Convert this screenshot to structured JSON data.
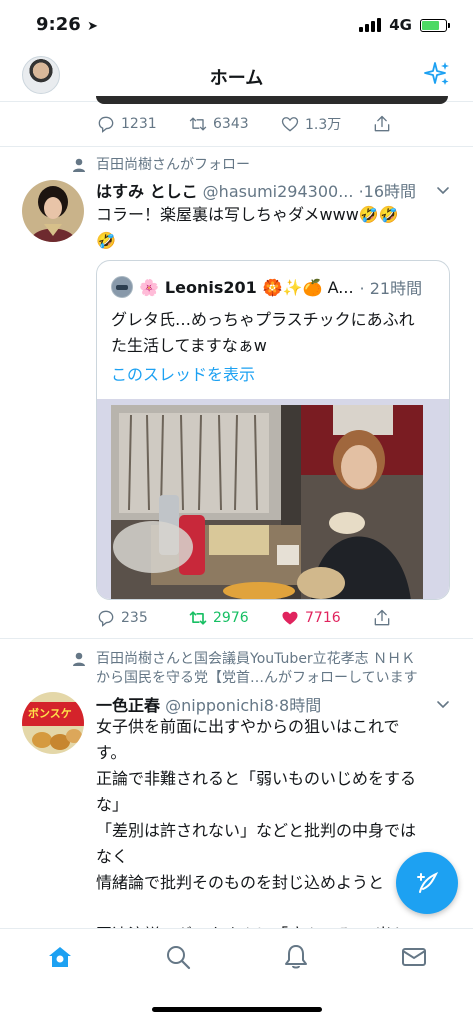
{
  "status_bar": {
    "time": "9:26",
    "network": "4G"
  },
  "header": {
    "title": "ホーム"
  },
  "previous_tweet": {
    "actions": {
      "replies": "1231",
      "retweets": "6343",
      "likes": "1.3万"
    }
  },
  "tweet1": {
    "social_context": "百田尚樹さんがフォロー",
    "name": "はすみ としこ",
    "handle": "@hasumi294300...",
    "time": "·16時間",
    "text_line1": "コラー！楽屋裏は写しちゃダメwww🤣🤣",
    "text_line2": "🤣",
    "quote": {
      "emojis_before": "🌸",
      "name": "Leonis201",
      "emojis_after": "🏵️✨🍊 A...",
      "time": "· 21時間",
      "text_line1": "グレタ氏…めっちゃプラスチックにあふれ",
      "text_line2": "た生活してますなぁw",
      "thread_link": "このスレッドを表示"
    },
    "actions": {
      "replies": "235",
      "retweets": "2976",
      "likes": "7716"
    },
    "colors": {
      "retweet_active": "#17bf63",
      "like_active": "#e0245e"
    }
  },
  "tweet2": {
    "social_context_line1": "百田尚樹さんと国会議員YouTuber立花孝志 ＮＨＫ",
    "social_context_line2": "から国民を守る党【党首…んがフォローしています",
    "avatar_text": "ボンスケ",
    "name": "一色正春",
    "handle": "@nipponichi8",
    "time": "·8時間",
    "lines": [
      "女子供を前面に出すやからの狙いはこれで",
      "す。",
      "正論で非難されると「弱いものいじめをする",
      "な」",
      "「差別は許されない」などと批判の中身では",
      "なく",
      "情緒論で批判そのものを封じ込めようと",
      "",
      "国連演説のグレタさんに「病んでる」　米ト"
    ]
  },
  "tabbar": {
    "items": [
      "home-icon",
      "search-icon",
      "notifications-icon",
      "messages-icon"
    ]
  },
  "colors": {
    "accent": "#1da1f2",
    "text_secondary": "#657786",
    "divider": "#e6ecf0"
  }
}
